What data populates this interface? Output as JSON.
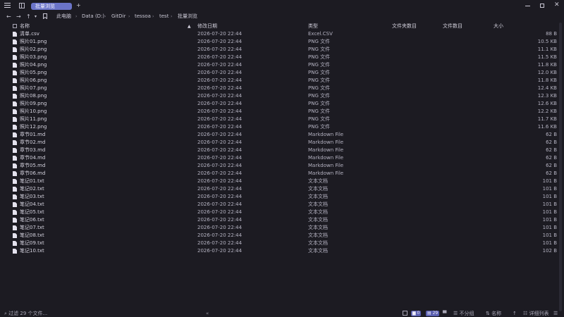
{
  "window": {
    "tab_label": "批量浏览",
    "add_tab": "+",
    "minimize": "—",
    "maximize": "□",
    "close": "✕"
  },
  "nav": {
    "back": "←",
    "forward": "→",
    "up": "↑",
    "bookmark_icon": "bookmark-icon",
    "breadcrumb": [
      "此电脑",
      "Data (D:)",
      "GitDir",
      "tessoa",
      "test",
      "批量浏览"
    ],
    "separator": "›"
  },
  "columns": {
    "name": "名称",
    "modified": "修改日期",
    "type": "类型",
    "folder_count": "文件夹数目",
    "file_count": "文件数目",
    "size": "大小"
  },
  "files": [
    {
      "name": "清单.csv",
      "date": "2026-07-20 22:44",
      "type": "Excel.CSV",
      "size": "88 B"
    },
    {
      "name": "照片01.png",
      "date": "2026-07-20 22:44",
      "type": "PNG 文件",
      "size": "10.5 KB"
    },
    {
      "name": "照片02.png",
      "date": "2026-07-20 22:44",
      "type": "PNG 文件",
      "size": "11.1 KB"
    },
    {
      "name": "照片03.png",
      "date": "2026-07-20 22:44",
      "type": "PNG 文件",
      "size": "11.5 KB"
    },
    {
      "name": "照片04.png",
      "date": "2026-07-20 22:44",
      "type": "PNG 文件",
      "size": "11.8 KB"
    },
    {
      "name": "照片05.png",
      "date": "2026-07-20 22:44",
      "type": "PNG 文件",
      "size": "12.0 KB"
    },
    {
      "name": "照片06.png",
      "date": "2026-07-20 22:44",
      "type": "PNG 文件",
      "size": "11.8 KB"
    },
    {
      "name": "照片07.png",
      "date": "2026-07-20 22:44",
      "type": "PNG 文件",
      "size": "12.4 KB"
    },
    {
      "name": "照片08.png",
      "date": "2026-07-20 22:44",
      "type": "PNG 文件",
      "size": "12.3 KB"
    },
    {
      "name": "照片09.png",
      "date": "2026-07-20 22:44",
      "type": "PNG 文件",
      "size": "12.6 KB"
    },
    {
      "name": "照片10.png",
      "date": "2026-07-20 22:44",
      "type": "PNG 文件",
      "size": "12.2 KB"
    },
    {
      "name": "照片11.png",
      "date": "2026-07-20 22:44",
      "type": "PNG 文件",
      "size": "11.7 KB"
    },
    {
      "name": "照片12.png",
      "date": "2026-07-20 22:44",
      "type": "PNG 文件",
      "size": "11.6 KB"
    },
    {
      "name": "章节01.md",
      "date": "2026-07-20 22:44",
      "type": "Markdown File",
      "size": "62 B"
    },
    {
      "name": "章节02.md",
      "date": "2026-07-20 22:44",
      "type": "Markdown File",
      "size": "62 B"
    },
    {
      "name": "章节03.md",
      "date": "2026-07-20 22:44",
      "type": "Markdown File",
      "size": "62 B"
    },
    {
      "name": "章节04.md",
      "date": "2026-07-20 22:44",
      "type": "Markdown File",
      "size": "62 B"
    },
    {
      "name": "章节05.md",
      "date": "2026-07-20 22:44",
      "type": "Markdown File",
      "size": "62 B"
    },
    {
      "name": "章节06.md",
      "date": "2026-07-20 22:44",
      "type": "Markdown File",
      "size": "62 B"
    },
    {
      "name": "笔记01.txt",
      "date": "2026-07-20 22:44",
      "type": "文本文档",
      "size": "101 B"
    },
    {
      "name": "笔记02.txt",
      "date": "2026-07-20 22:44",
      "type": "文本文档",
      "size": "101 B"
    },
    {
      "name": "笔记03.txt",
      "date": "2026-07-20 22:44",
      "type": "文本文档",
      "size": "101 B"
    },
    {
      "name": "笔记04.txt",
      "date": "2026-07-20 22:44",
      "type": "文本文档",
      "size": "101 B"
    },
    {
      "name": "笔记05.txt",
      "date": "2026-07-20 22:44",
      "type": "文本文档",
      "size": "101 B"
    },
    {
      "name": "笔记06.txt",
      "date": "2026-07-20 22:44",
      "type": "文本文档",
      "size": "101 B"
    },
    {
      "name": "笔记07.txt",
      "date": "2026-07-20 22:44",
      "type": "文本文档",
      "size": "101 B"
    },
    {
      "name": "笔记08.txt",
      "date": "2026-07-20 22:44",
      "type": "文本文档",
      "size": "101 B"
    },
    {
      "name": "笔记09.txt",
      "date": "2026-07-20 22:44",
      "type": "文本文档",
      "size": "101 B"
    },
    {
      "name": "笔记10.txt",
      "date": "2026-07-20 22:44",
      "type": "文本文档",
      "size": "102 B"
    }
  ],
  "status": {
    "filter_placeholder": "过滤 29 个文件...",
    "folder_count": "0",
    "file_count": "29",
    "grouping": "不分组",
    "sort_by": "名称",
    "view_mode": "详细列表"
  },
  "colors": {
    "background": "#1c1b22",
    "accent": "#6b74c8"
  }
}
